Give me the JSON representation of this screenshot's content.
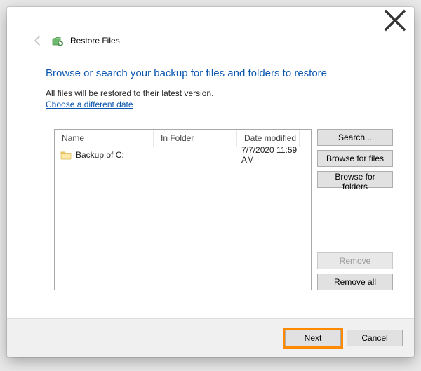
{
  "window": {
    "title": "Restore Files"
  },
  "page": {
    "heading": "Browse or search your backup for files and folders to restore",
    "subtext": "All files will be restored to their latest version.",
    "link": "Choose a different date"
  },
  "list": {
    "columns": {
      "name": "Name",
      "in_folder": "In Folder",
      "date_modified": "Date modified"
    },
    "rows": [
      {
        "name": "Backup of C:",
        "in_folder": "",
        "date_modified": "7/7/2020 11:59 AM"
      }
    ]
  },
  "side": {
    "search": "Search...",
    "browse_files": "Browse for files",
    "browse_folders": "Browse for folders",
    "remove": "Remove",
    "remove_all": "Remove all"
  },
  "footer": {
    "next": "Next",
    "cancel": "Cancel"
  }
}
